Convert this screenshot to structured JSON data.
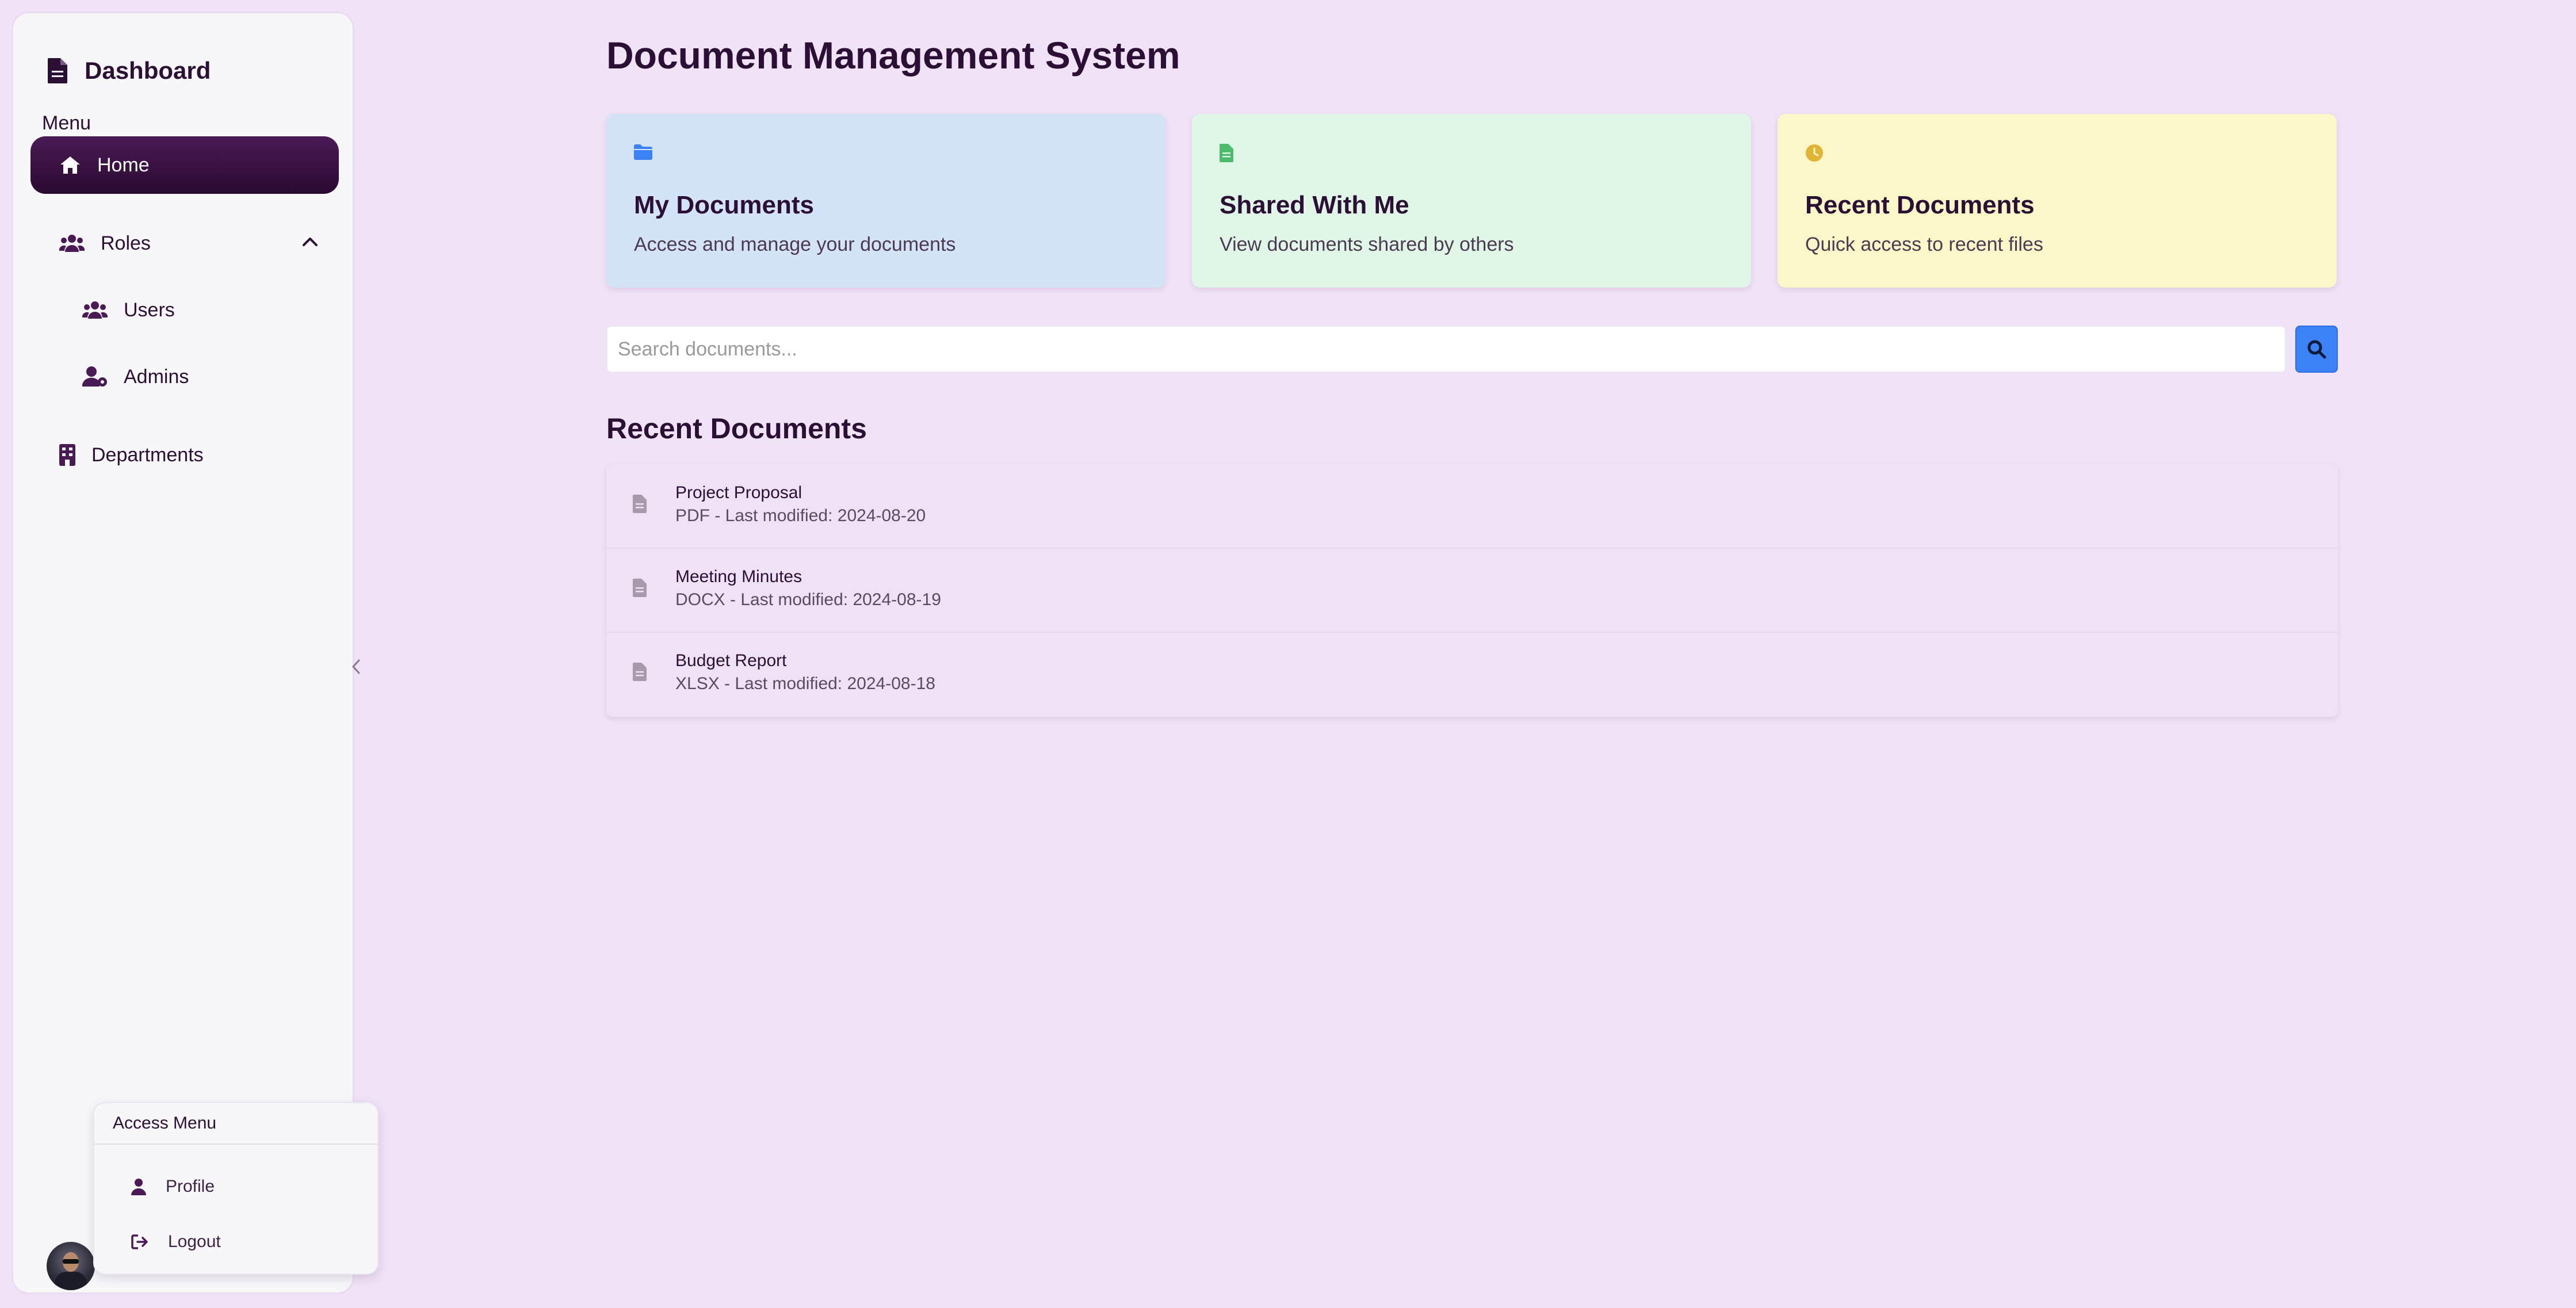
{
  "sidebar": {
    "brand_title": "Dashboard",
    "menu_label": "Menu",
    "items": [
      {
        "label": "Home",
        "icon": "home-icon",
        "active": true
      },
      {
        "label": "Roles",
        "icon": "users-icon",
        "expanded": true
      },
      {
        "label": "Users",
        "icon": "users-icon"
      },
      {
        "label": "Admins",
        "icon": "user-gear-icon"
      },
      {
        "label": "Departments",
        "icon": "building-icon"
      }
    ]
  },
  "account_menu": {
    "title": "Access Menu",
    "items": [
      {
        "label": "Profile",
        "icon": "user-icon"
      },
      {
        "label": "Logout",
        "icon": "logout-icon"
      }
    ]
  },
  "main": {
    "title": "Document Management System",
    "cards": [
      {
        "title": "My Documents",
        "description": "Access and manage your documents",
        "icon": "folder-icon",
        "bg": "#d3e3f8",
        "icon_color": "#3b82f6"
      },
      {
        "title": "Shared With Me",
        "description": "View documents shared by others",
        "icon": "file-icon",
        "bg": "#e0f7e7",
        "icon_color": "#4cbb6c"
      },
      {
        "title": "Recent Documents",
        "description": "Quick access to recent files",
        "icon": "clock-icon",
        "bg": "#fcf7c9",
        "icon_color": "#e2b434"
      }
    ],
    "search": {
      "placeholder": "Search documents...",
      "value": ""
    },
    "recent_title": "Recent Documents",
    "documents": [
      {
        "name": "Project Proposal",
        "meta": "PDF - Last modified: 2024-08-20"
      },
      {
        "name": "Meeting Minutes",
        "meta": "DOCX - Last modified: 2024-08-19"
      },
      {
        "name": "Budget Report",
        "meta": "XLSX - Last modified: 2024-08-18"
      }
    ]
  }
}
